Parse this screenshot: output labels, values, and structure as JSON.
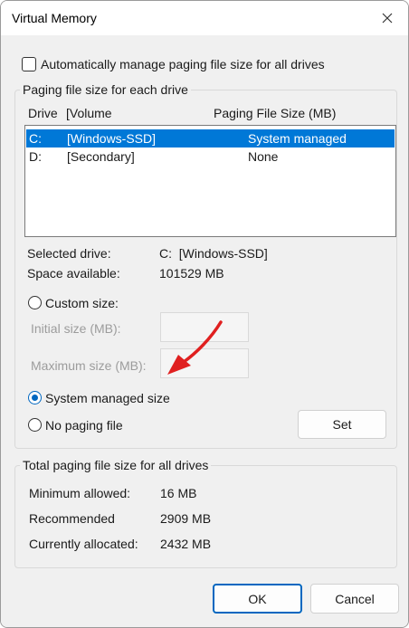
{
  "window": {
    "title": "Virtual Memory",
    "close_icon": "close-icon"
  },
  "auto_manage": {
    "label": "Automatically manage paging file size for all drives",
    "checked": false
  },
  "paging_group": {
    "title": "Paging file size for each drive",
    "columns": {
      "drive": "Drive",
      "volume": "[Volume",
      "size": "Paging File Size (MB)"
    },
    "rows": [
      {
        "drive": "C:",
        "volume": "[Windows-SSD]",
        "size": "System managed",
        "selected": true
      },
      {
        "drive": "D:",
        "volume": "[Secondary]",
        "size": "None",
        "selected": false
      }
    ],
    "selected_drive_label": "Selected drive:",
    "selected_drive_value": "C:  [Windows-SSD]",
    "space_available_label": "Space available:",
    "space_available_value": "101529 MB",
    "custom_size_label": "Custom size:",
    "initial_size_label": "Initial size (MB):",
    "initial_size_value": "",
    "maximum_size_label": "Maximum size (MB):",
    "maximum_size_value": "",
    "system_managed_label": "System managed size",
    "no_paging_label": "No paging file",
    "set_button": "Set",
    "selected_option": "system_managed"
  },
  "total_group": {
    "title": "Total paging file size for all drives",
    "minimum_label": "Minimum allowed:",
    "minimum_value": "16 MB",
    "recommended_label": "Recommended",
    "recommended_value": "2909 MB",
    "allocated_label": "Currently allocated:",
    "allocated_value": "2432 MB"
  },
  "footer": {
    "ok_button": "OK",
    "cancel_button": "Cancel"
  },
  "annotation": {
    "arrow_color": "#e02020"
  },
  "colors": {
    "accent": "#0067c0",
    "selection": "#0078d7"
  }
}
